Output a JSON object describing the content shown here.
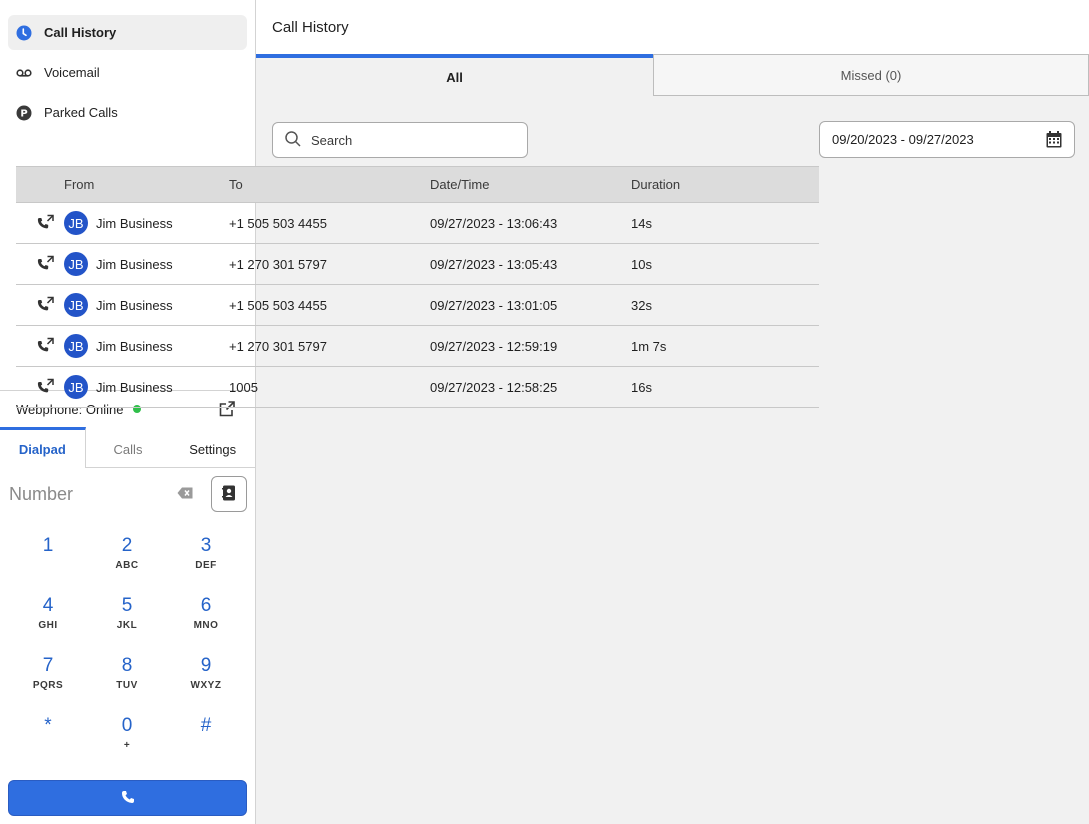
{
  "sidebar": {
    "items": [
      {
        "label": "Call History",
        "icon": "clock-icon",
        "active": true
      },
      {
        "label": "Voicemail",
        "icon": "voicemail-icon",
        "active": false
      },
      {
        "label": "Parked Calls",
        "icon": "parking-icon",
        "active": false
      }
    ]
  },
  "webphone": {
    "status_label": "Webphone: Online",
    "status_color": "#2fbf4a",
    "tabs": [
      {
        "label": "Dialpad",
        "active": true
      },
      {
        "label": "Calls",
        "active": false
      },
      {
        "label": "Settings",
        "active": false
      }
    ],
    "number_placeholder": "Number",
    "keys": [
      {
        "digit": "1",
        "letters": ""
      },
      {
        "digit": "2",
        "letters": "ABC"
      },
      {
        "digit": "3",
        "letters": "DEF"
      },
      {
        "digit": "4",
        "letters": "GHI"
      },
      {
        "digit": "5",
        "letters": "JKL"
      },
      {
        "digit": "6",
        "letters": "MNO"
      },
      {
        "digit": "7",
        "letters": "PQRS"
      },
      {
        "digit": "8",
        "letters": "TUV"
      },
      {
        "digit": "9",
        "letters": "WXYZ"
      },
      {
        "digit": "*",
        "letters": ""
      },
      {
        "digit": "0",
        "letters": "+"
      },
      {
        "digit": "#",
        "letters": ""
      }
    ]
  },
  "main": {
    "title": "Call History",
    "tabs": [
      {
        "label": "All",
        "active": true
      },
      {
        "label": "Missed (0)",
        "active": false
      }
    ],
    "search_placeholder": "Search",
    "date_range": "09/20/2023 - 09/27/2023",
    "table": {
      "headers": [
        "From",
        "To",
        "Date/Time",
        "Duration"
      ],
      "rows": [
        {
          "initials": "JB",
          "from": "Jim Business",
          "to": "+1 505 503 4455",
          "datetime": "09/27/2023 - 13:06:43",
          "duration": "14s"
        },
        {
          "initials": "JB",
          "from": "Jim Business",
          "to": "+1 270 301 5797",
          "datetime": "09/27/2023 - 13:05:43",
          "duration": "10s"
        },
        {
          "initials": "JB",
          "from": "Jim Business",
          "to": "+1 505 503 4455",
          "datetime": "09/27/2023 - 13:01:05",
          "duration": "32s"
        },
        {
          "initials": "JB",
          "from": "Jim Business",
          "to": "+1 270 301 5797",
          "datetime": "09/27/2023 - 12:59:19",
          "duration": "1m 7s"
        },
        {
          "initials": "JB",
          "from": "Jim Business",
          "to": "1005",
          "datetime": "09/27/2023 - 12:58:25",
          "duration": "16s"
        }
      ]
    }
  },
  "colors": {
    "accent": "#2f6ee0",
    "avatar": "#2354c8",
    "online": "#2fbf4a"
  }
}
